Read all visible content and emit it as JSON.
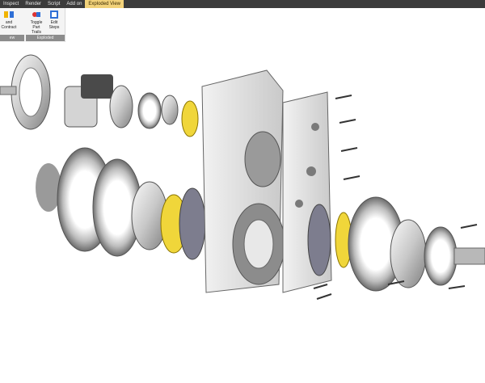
{
  "menubar": {
    "tabs": [
      "Inspect",
      "Render",
      "Script",
      "Add on",
      "Exploded View"
    ],
    "active_tab": "Exploded View"
  },
  "ribbon": {
    "buttons": [
      {
        "label": "and Contract",
        "icon": "expand-contract-icon"
      },
      {
        "label": "Toggle\nPart Trails",
        "icon": "toggle-trails-icon"
      },
      {
        "label": "Edit\nSteps",
        "icon": "edit-steps-icon"
      }
    ],
    "group_label_1": "ew",
    "group_label_2": "Exploded",
    "accent": "#f2d27a"
  },
  "viewport": {
    "content": "exploded-gearbox-model"
  }
}
